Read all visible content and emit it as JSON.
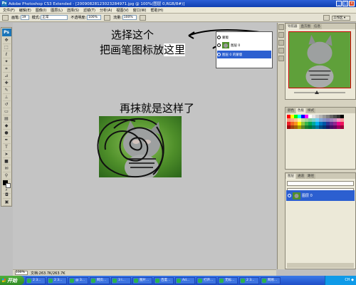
{
  "window": {
    "app_icon": "Ps",
    "title": "Adobe Photoshop CS3 Extended - [20090828123023284971.jpg @ 100%(图层 0,RGB/8#)]",
    "minimize_icon": "minimize-icon",
    "maximize_icon": "maximize-icon",
    "close_icon": "close-icon"
  },
  "menu": [
    "文件(F)",
    "编辑(E)",
    "图像(I)",
    "图层(L)",
    "选择(S)",
    "滤镜(T)",
    "分析(A)",
    "视图(V)",
    "窗口(W)",
    "帮助(H)"
  ],
  "options": {
    "brush_label": "画笔:",
    "brush_size": "19",
    "mode_label": "模式:",
    "mode_value": "正常",
    "opacity_label": "不透明度:",
    "opacity_value": "100%",
    "flow_label": "流量:",
    "flow_value": "100%",
    "workspace_label": "工作区 ▾"
  },
  "annotations": {
    "line1": "选择这个",
    "line2": "把画笔图标放",
    "line2_highlight": "这里",
    "line3": "再抹就是这样了"
  },
  "layer_menu": {
    "rows": [
      {
        "label": "蒙版"
      },
      {
        "label": "图层 0"
      },
      {
        "label": "图层 0 的蒙版"
      }
    ]
  },
  "panels": {
    "navigator_tabs": [
      "导航器",
      "直方图",
      "信息"
    ],
    "swatches_tabs": [
      "颜色",
      "色板",
      "样式"
    ],
    "layers_tabs": [
      "图层",
      "通道",
      "路径"
    ],
    "layer_name": "图层 0",
    "swatch_colors": [
      "#ff0000",
      "#ffff00",
      "#00ff00",
      "#00ffff",
      "#0000ff",
      "#ff00ff",
      "#ffffff",
      "#e6e6e6",
      "#cccccc",
      "#b3b3b3",
      "#999999",
      "#808080",
      "#666666",
      "#4d4d4d",
      "#333333",
      "#000000",
      "#f7977a",
      "#f9ad81",
      "#fdc68a",
      "#fff79a",
      "#c4df9b",
      "#a3d39c",
      "#82ca9d",
      "#7bcdc8",
      "#6ecff6",
      "#7ea7d8",
      "#8493ca",
      "#8882be",
      "#a187be",
      "#bc8dbf",
      "#f49ac2",
      "#f6989d",
      "#ed1c24",
      "#f26522",
      "#f7941d",
      "#fff200",
      "#8dc63f",
      "#39b54a",
      "#00a651",
      "#00a99d",
      "#00aeef",
      "#0072bc",
      "#0054a6",
      "#2e3192",
      "#662d91",
      "#92278f",
      "#ec008c",
      "#ed145b",
      "#9e0b0f",
      "#a0410d",
      "#a36209",
      "#aba000",
      "#598527",
      "#197b30",
      "#007236",
      "#00746b",
      "#0076a3",
      "#004a80",
      "#003471",
      "#1b1464",
      "#440e62",
      "#630460",
      "#9e005d",
      "#9e0039"
    ]
  },
  "status": {
    "zoom": "100%",
    "doc_info": "文档:263.7K/263.7K"
  },
  "taskbar": {
    "start_label": "开始",
    "buttons": [
      "2 3...",
      "2 3...",
      "@ 3...",
      "网页...",
      "3 I...",
      "图片...",
      "百度...",
      "Ad...",
      "打开...",
      "无标...",
      "2 3...",
      "网易..."
    ],
    "tray_text": "CH ◆"
  },
  "colors": {
    "titlebar": "#1449c4",
    "selected_row": "#2c5fd0",
    "canvas_gray": "#c4c4c4"
  }
}
